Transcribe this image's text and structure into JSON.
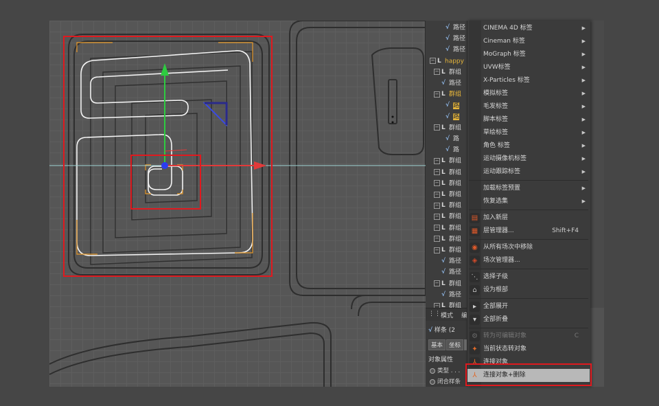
{
  "tree": {
    "rows": [
      {
        "label": "路径",
        "icon": "spline-icon",
        "indent": 2,
        "style": "normal"
      },
      {
        "label": "路径",
        "icon": "spline-icon",
        "indent": 2,
        "style": "normal"
      },
      {
        "label": "路径",
        "icon": "spline-icon",
        "indent": 2,
        "style": "normal"
      },
      {
        "label": "happy",
        "icon": "null-object-icon",
        "indent": 0,
        "style": "highlight"
      },
      {
        "label": "群组",
        "icon": "null-object-icon",
        "indent": 1,
        "style": "normal"
      },
      {
        "label": "路径",
        "icon": "spline-icon",
        "indent": 1,
        "style": "normal"
      },
      {
        "label": "群组",
        "icon": "null-object-icon",
        "indent": 1,
        "style": "highlight"
      },
      {
        "label": "路",
        "icon": "spline-icon",
        "indent": 2,
        "style": "selected"
      },
      {
        "label": "路",
        "icon": "spline-icon",
        "indent": 2,
        "style": "selected"
      },
      {
        "label": "群组",
        "icon": "null-object-icon",
        "indent": 1,
        "style": "normal"
      },
      {
        "label": "路",
        "icon": "spline-icon",
        "indent": 2,
        "style": "normal"
      },
      {
        "label": "路",
        "icon": "spline-icon",
        "indent": 2,
        "style": "normal"
      },
      {
        "label": "群组",
        "icon": "null-object-icon",
        "indent": 1,
        "style": "normal"
      },
      {
        "label": "群组",
        "icon": "null-object-icon",
        "indent": 1,
        "style": "normal"
      },
      {
        "label": "群组",
        "icon": "null-object-icon",
        "indent": 1,
        "style": "normal"
      },
      {
        "label": "群组",
        "icon": "null-object-icon",
        "indent": 1,
        "style": "normal"
      },
      {
        "label": "群组",
        "icon": "null-object-icon",
        "indent": 1,
        "style": "normal"
      },
      {
        "label": "群组",
        "icon": "null-object-icon",
        "indent": 1,
        "style": "normal"
      },
      {
        "label": "群组",
        "icon": "null-object-icon",
        "indent": 1,
        "style": "normal"
      },
      {
        "label": "群组",
        "icon": "null-object-icon",
        "indent": 1,
        "style": "normal"
      },
      {
        "label": "群组",
        "icon": "null-object-icon",
        "indent": 1,
        "style": "normal"
      },
      {
        "label": "路径",
        "icon": "spline-icon",
        "indent": 1,
        "style": "normal"
      },
      {
        "label": "路径",
        "icon": "spline-icon",
        "indent": 1,
        "style": "normal"
      },
      {
        "label": "群组",
        "icon": "null-object-icon",
        "indent": 1,
        "style": "normal"
      },
      {
        "label": "路径",
        "icon": "spline-icon",
        "indent": 1,
        "style": "normal"
      },
      {
        "label": "群组",
        "icon": "null-object-icon",
        "indent": 1,
        "style": "normal"
      }
    ]
  },
  "attributes": {
    "tabs": [
      "模式",
      "编"
    ],
    "object_line": "样条 (2",
    "buttons": [
      "基本",
      "坐标",
      "对"
    ],
    "section_title": "对象属性",
    "props": [
      "类型 . . .",
      "闭合样条"
    ]
  },
  "context_menu": {
    "items": [
      {
        "label": "CINEMA 4D 标签",
        "submenu": true,
        "icon": "",
        "shortcut": "",
        "state": "normal"
      },
      {
        "label": "Cineman 标签",
        "submenu": true,
        "icon": "",
        "shortcut": "",
        "state": "normal"
      },
      {
        "label": "MoGraph 标签",
        "submenu": true,
        "icon": "",
        "shortcut": "",
        "state": "normal"
      },
      {
        "label": "UVW标签",
        "submenu": true,
        "icon": "",
        "shortcut": "",
        "state": "normal"
      },
      {
        "label": "X-Particles 标签",
        "submenu": true,
        "icon": "",
        "shortcut": "",
        "state": "normal"
      },
      {
        "label": "模拟标签",
        "submenu": true,
        "icon": "",
        "shortcut": "",
        "state": "normal"
      },
      {
        "label": "毛发标签",
        "submenu": true,
        "icon": "",
        "shortcut": "",
        "state": "normal"
      },
      {
        "label": "脚本标签",
        "submenu": true,
        "icon": "",
        "shortcut": "",
        "state": "normal"
      },
      {
        "label": "草绘标签",
        "submenu": true,
        "icon": "",
        "shortcut": "",
        "state": "normal"
      },
      {
        "label": "角色 标签",
        "submenu": true,
        "icon": "",
        "shortcut": "",
        "state": "normal"
      },
      {
        "label": "运动摄像机标签",
        "submenu": true,
        "icon": "",
        "shortcut": "",
        "state": "normal"
      },
      {
        "label": "运动跟踪标签",
        "submenu": true,
        "icon": "",
        "shortcut": "",
        "state": "normal"
      },
      {
        "sep": true
      },
      {
        "label": "加载标签预置",
        "submenu": true,
        "icon": "",
        "shortcut": "",
        "state": "normal"
      },
      {
        "label": "恢复选集",
        "submenu": true,
        "icon": "",
        "shortcut": "",
        "state": "normal"
      },
      {
        "sep": true
      },
      {
        "label": "加入新层",
        "submenu": false,
        "icon": "layer-add-icon",
        "shortcut": "",
        "state": "normal"
      },
      {
        "label": "层管理器...",
        "submenu": false,
        "icon": "layer-manager-icon",
        "shortcut": "Shift+F4",
        "state": "normal"
      },
      {
        "sep": true
      },
      {
        "label": "从所有场次中移除",
        "submenu": false,
        "icon": "remove-takes-icon",
        "shortcut": "",
        "state": "normal"
      },
      {
        "label": "场次管理器...",
        "submenu": false,
        "icon": "take-manager-icon",
        "shortcut": "",
        "state": "normal"
      },
      {
        "sep": true
      },
      {
        "label": "选择子级",
        "submenu": false,
        "icon": "select-children-icon",
        "shortcut": "",
        "state": "normal"
      },
      {
        "label": "设为根部",
        "submenu": false,
        "icon": "set-root-icon",
        "shortcut": "",
        "state": "normal"
      },
      {
        "sep": true
      },
      {
        "label": "全部展开",
        "submenu": false,
        "icon": "expand-all-icon",
        "shortcut": "",
        "state": "normal"
      },
      {
        "label": "全部折叠",
        "submenu": false,
        "icon": "collapse-all-icon",
        "shortcut": "",
        "state": "normal"
      },
      {
        "sep": true
      },
      {
        "label": "转为可编辑对象",
        "submenu": false,
        "icon": "make-editable-icon",
        "shortcut": "C",
        "state": "disabled"
      },
      {
        "label": "当前状态转对象",
        "submenu": false,
        "icon": "current-state-icon",
        "shortcut": "",
        "state": "normal"
      },
      {
        "label": "连接对象",
        "submenu": false,
        "icon": "connect-objects-icon",
        "shortcut": "",
        "state": "normal"
      },
      {
        "label": "连接对象+删除",
        "submenu": false,
        "icon": "connect-delete-icon",
        "shortcut": "",
        "state": "active"
      }
    ]
  },
  "colors": {
    "highlight_red": "#e0191e",
    "selection_orange": "#e6b53a",
    "axis_x": "#e33a3a",
    "axis_y": "#2ecc40",
    "axis_z": "#3a4ae3"
  }
}
